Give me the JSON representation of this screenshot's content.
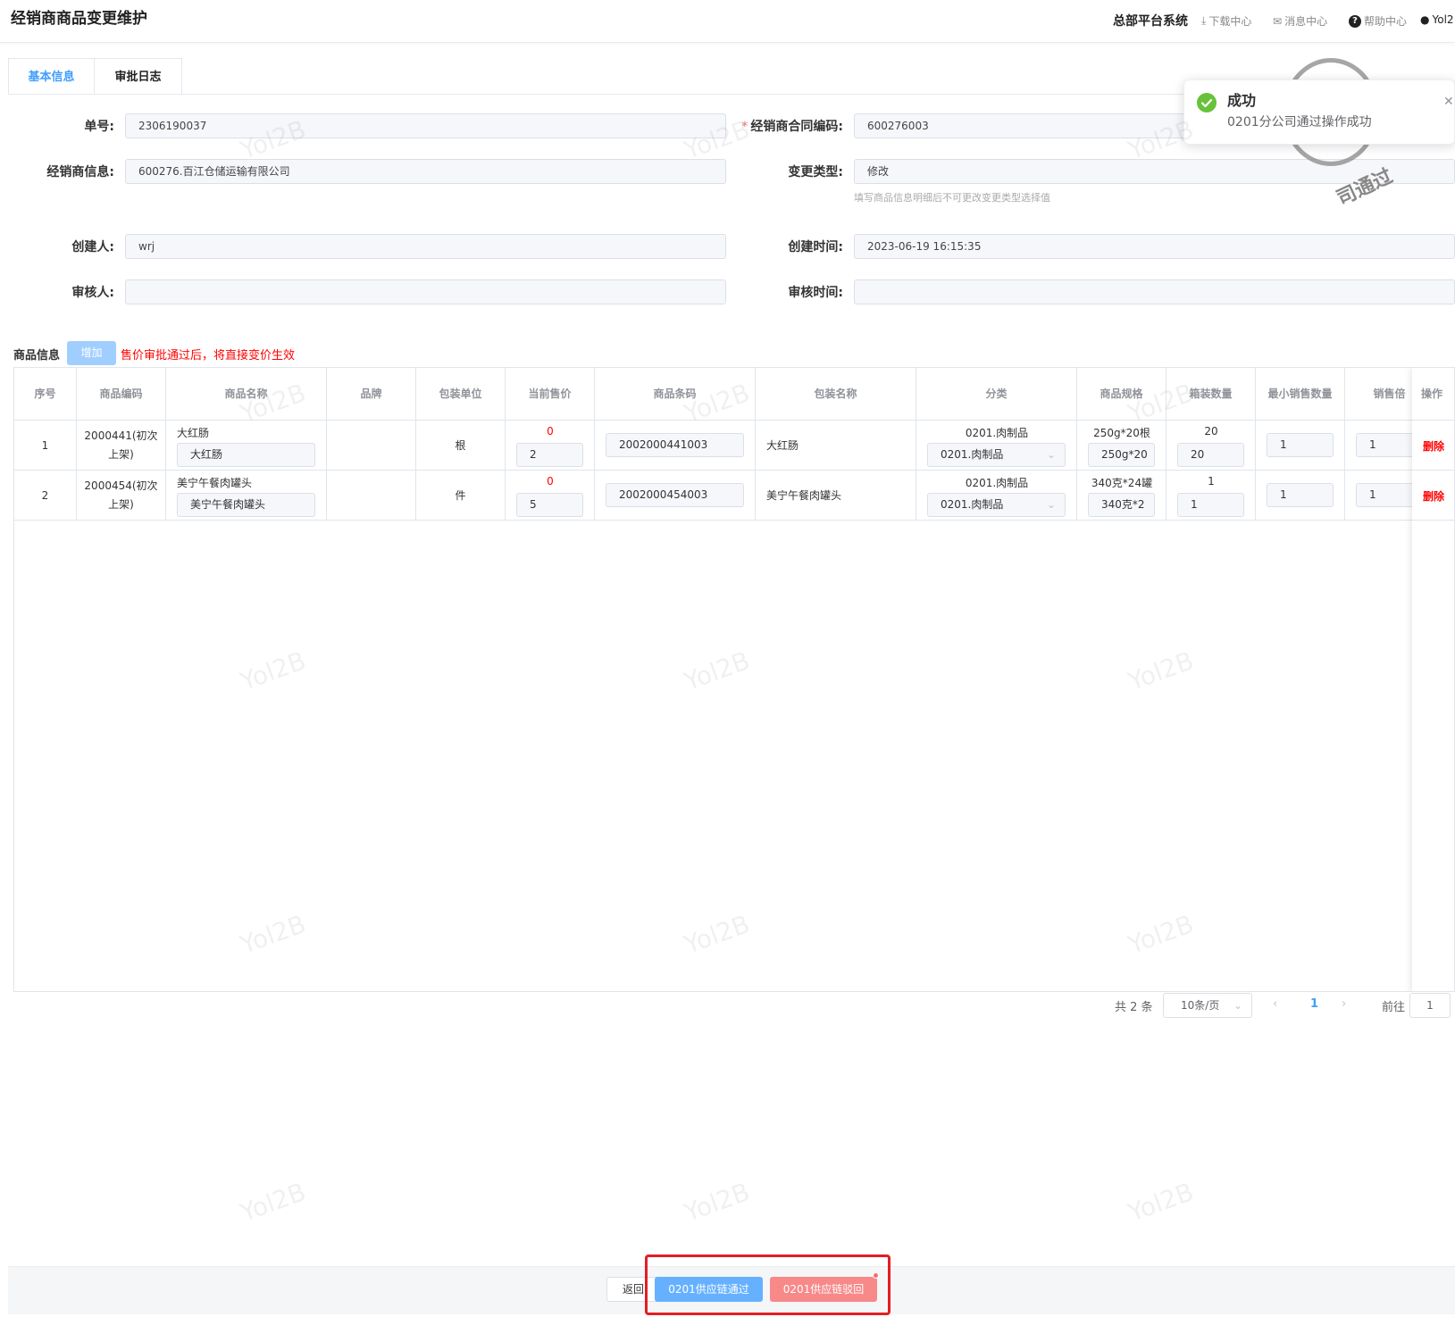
{
  "header": {
    "title": "经销商商品变更维护",
    "system": "总部平台系统",
    "download": "下载中心",
    "messages": "消息中心",
    "help": "帮助中心",
    "user": "Yol2"
  },
  "tabs": [
    "基本信息",
    "审批日志"
  ],
  "form": {
    "order_no_label": "单号:",
    "order_no": "2306190037",
    "contract_label": "经销商合同编码:",
    "contract": "600276003",
    "dealer_label": "经销商信息:",
    "dealer": "600276.百江仓储运输有限公司",
    "change_type_label": "变更类型:",
    "change_type": "修改",
    "change_type_hint": "填写商品信息明细后不可更改变更类型选择值",
    "creator_label": "创建人:",
    "creator": "wrj",
    "created_label": "创建时间:",
    "created": "2023-06-19 16:15:35",
    "auditor_label": "审核人:",
    "auditor": "",
    "audit_time_label": "审核时间:",
    "audit_time": ""
  },
  "products": {
    "label": "商品信息",
    "add_button": "增加",
    "note": "售价审批通过后，将直接变价生效",
    "columns": [
      "序号",
      "商品编码",
      "商品名称",
      "品牌",
      "包装单位",
      "当前售价",
      "商品条码",
      "包装名称",
      "分类",
      "商品规格",
      "箱装数量",
      "最小销售数量",
      "销售倍",
      "操作"
    ],
    "rows": [
      {
        "index": "1",
        "code_a": "2000441(初次",
        "code_b": "上架)",
        "name": "大红肠",
        "name_input": "大红肠",
        "brand": "",
        "unit": "根",
        "price_current": "0",
        "price_input": "2",
        "barcode": "2002000441003",
        "pack_name": "大红肠",
        "category": "0201.肉制品",
        "category_select": "0201.肉制品",
        "spec": "250g*20根",
        "spec_input": "250g*20",
        "box_qty": "20",
        "box_qty_input": "20",
        "min_qty": "1",
        "multiple": "1",
        "action": "删除"
      },
      {
        "index": "2",
        "code_a": "2000454(初次",
        "code_b": "上架)",
        "name": "美宁午餐肉罐头",
        "name_input": "美宁午餐肉罐头",
        "brand": "",
        "unit": "件",
        "price_current": "0",
        "price_input": "5",
        "barcode": "2002000454003",
        "pack_name": "美宁午餐肉罐头",
        "category": "0201.肉制品",
        "category_select": "0201.肉制品",
        "spec": "340克*24罐",
        "spec_input": "340克*2",
        "box_qty": "1",
        "box_qty_input": "1",
        "min_qty": "1",
        "multiple": "1",
        "action": "删除"
      }
    ]
  },
  "pagination": {
    "total": "共 2 条",
    "page_size": "10条/页",
    "current": "1",
    "goto_label": "前往",
    "goto_value": "1"
  },
  "footer": {
    "back": "返回",
    "approve": "0201供应链通过",
    "reject": "0201供应链驳回"
  },
  "toast": {
    "title": "成功",
    "message": "0201分公司通过操作成功"
  },
  "stamp": {
    "text": "司通过"
  },
  "watermark": "Yol2B",
  "colors": {
    "primary": "#409eff",
    "success": "#67c23a",
    "danger": "#f56c6c",
    "highlight": "#e31e24"
  }
}
